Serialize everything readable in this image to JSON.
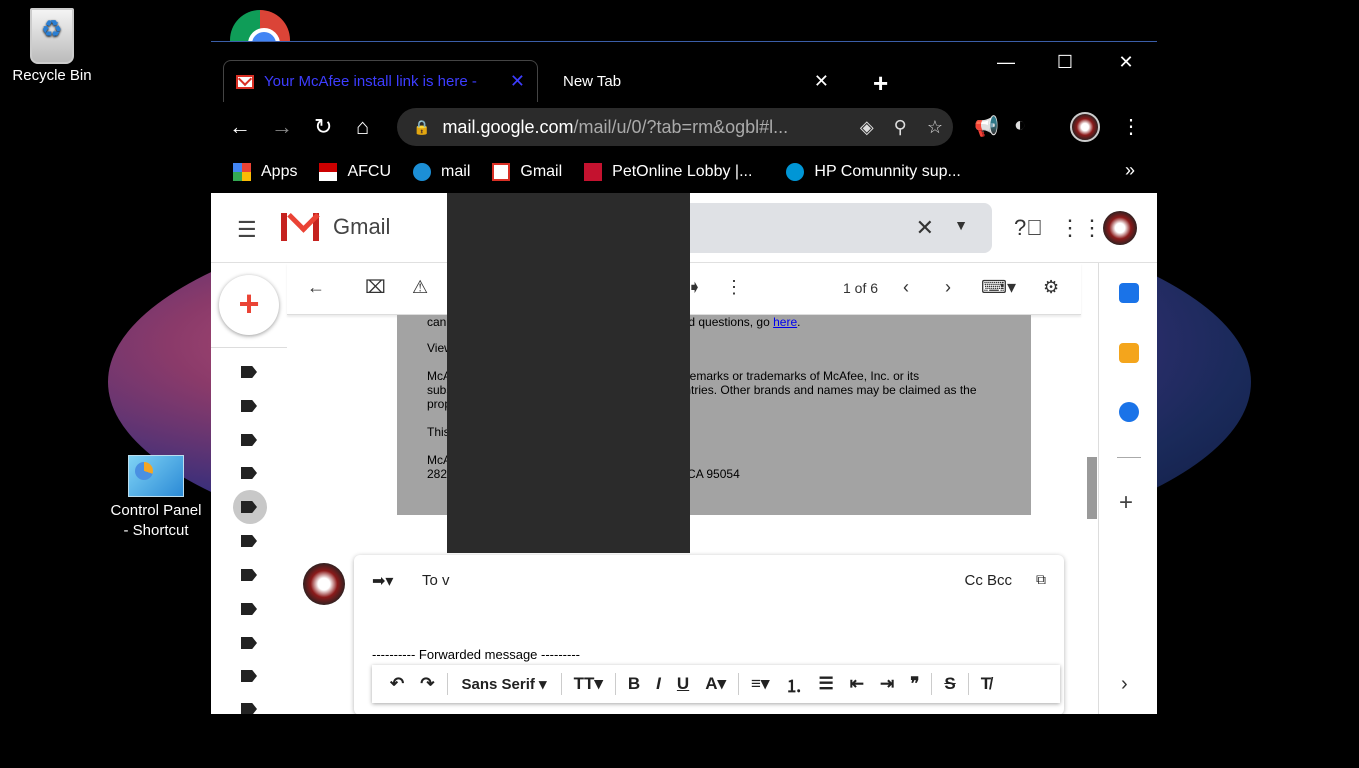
{
  "desktop": {
    "recycle_bin_label": "Recycle Bin",
    "control_panel_label": "Control Panel - Shortcut"
  },
  "browser": {
    "tabs": [
      {
        "title": "Your McAfee install link is here -",
        "active": true
      },
      {
        "title": "New Tab",
        "active": false
      }
    ],
    "window_controls": {
      "minimize": "—",
      "maximize": "☐",
      "close": "✕"
    },
    "url_host": "mail.google.com",
    "url_rest": "/mail/u/0/?tab=rm&ogbl#l...",
    "bookmarks": [
      {
        "label": "Apps",
        "icon": "apps-grid-icon"
      },
      {
        "label": "AFCU",
        "icon": "afcu-flag-icon"
      },
      {
        "label": "mail",
        "icon": "att-globe-icon"
      },
      {
        "label": "Gmail",
        "icon": "gmail-icon"
      },
      {
        "label": "PetOnline Lobby |...",
        "icon": "pet-icon"
      },
      {
        "label": "HP Comunnity sup...",
        "icon": "hp-icon"
      }
    ],
    "bookmarks_overflow": "»"
  },
  "gmail": {
    "product_name": "Gmail",
    "pager": "1 of 6",
    "message_lines": [
      {
        "text_a": "can",
        "text_b": "ted questions, go ",
        "link": "here",
        "tail": "."
      },
      {
        "text_a": "View",
        "text_b": ""
      },
      {
        "text_a": "McA",
        "text_b": "demarks or trademarks of McAfee, Inc. or its"
      },
      {
        "text_a": "subs",
        "text_b": "ntries. Other brands and names may be claimed as the"
      },
      {
        "text_a": "prop",
        "text_b": ""
      },
      {
        "text_a": "This",
        "text_b": ""
      },
      {
        "text_a": "McA",
        "text_b": ""
      },
      {
        "text_a": "282",
        "text_b": "CA 95054"
      }
    ],
    "reply": {
      "to_label": "To v",
      "cc_bcc": "Cc Bcc",
      "forwarded_line": "---------- Forwarded message ---------",
      "font_name": "Sans Serif"
    }
  },
  "colors": {
    "active_tab_text": "#3d3dff",
    "gmail_red": "#ea4335",
    "message_bg": "#a3a3a3",
    "redaction": "#2b2b2b"
  }
}
